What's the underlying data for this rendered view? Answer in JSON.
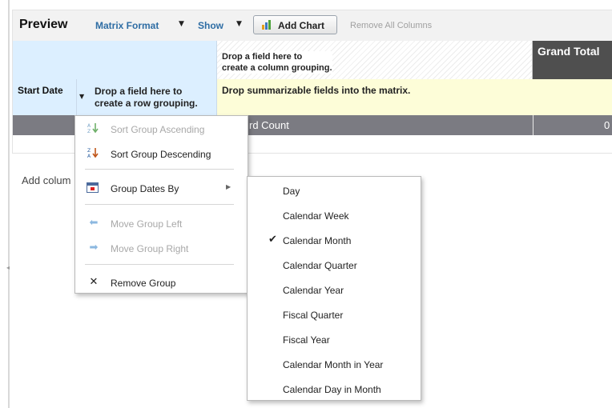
{
  "toolbar": {
    "title": "Preview",
    "matrix_format": "Matrix Format",
    "show": "Show",
    "caret": "▼",
    "add_chart": "Add Chart",
    "remove_all": "Remove All Columns"
  },
  "grid": {
    "column_drop_line1": "Drop a field here to",
    "column_drop_line2": "create a column grouping.",
    "grand_total": "Grand Total",
    "row_group_field": "Start Date",
    "row_drop_line1": "Drop a field here to",
    "row_drop_line2": "create a row grouping.",
    "summarizable_hint": "Drop summarizable fields into the matrix.",
    "record_count_label": "rd Count",
    "record_count_value": "0"
  },
  "add_columns_text": "Add colum",
  "context_menu": {
    "items": [
      {
        "label": "Sort Group Ascending",
        "icon": "sort-ascending-icon",
        "enabled": false
      },
      {
        "label": "Sort Group Descending",
        "icon": "sort-descending-icon",
        "enabled": true
      },
      {
        "label": "Group Dates By",
        "icon": "calendar-icon",
        "enabled": true,
        "has_submenu": true
      },
      {
        "label": "Move Group Left",
        "icon": "arrow-left-icon",
        "enabled": false
      },
      {
        "label": "Move Group Right",
        "icon": "arrow-right-icon",
        "enabled": false
      },
      {
        "label": "Remove Group",
        "icon": "close-icon",
        "enabled": true
      }
    ]
  },
  "group_dates_submenu": {
    "items": [
      {
        "label": "Day",
        "checked": false
      },
      {
        "label": "Calendar Week",
        "checked": false
      },
      {
        "label": "Calendar Month",
        "checked": true
      },
      {
        "label": "Calendar Quarter",
        "checked": false
      },
      {
        "label": "Calendar Year",
        "checked": false
      },
      {
        "label": "Fiscal Quarter",
        "checked": false
      },
      {
        "label": "Fiscal Year",
        "checked": false
      },
      {
        "label": "Calendar Month in Year",
        "checked": false
      },
      {
        "label": "Calendar Day in Month",
        "checked": false
      }
    ]
  },
  "colors": {
    "link_blue": "#2e6da4",
    "header_blue": "#dcefff",
    "summary_yellow": "#fdfdd8",
    "grand_total_bg": "#4f4f4f",
    "count_row_bg": "#7b7b82"
  }
}
